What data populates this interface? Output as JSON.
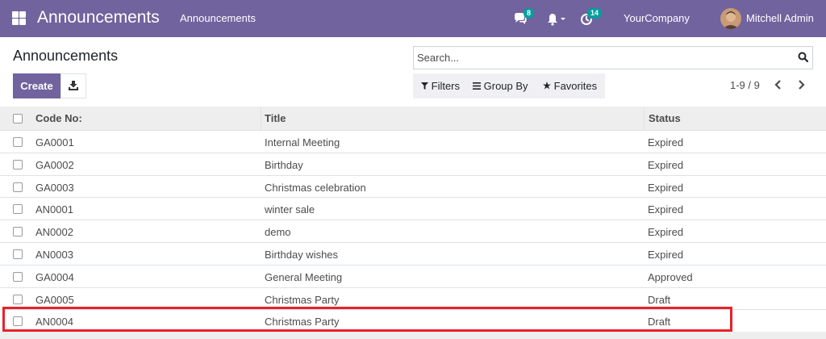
{
  "navbar": {
    "app_title": "Announcements",
    "menu_item": "Announcements",
    "chat_count": "8",
    "activity_count": "14",
    "company": "YourCompany",
    "user": "Mitchell Admin"
  },
  "control_panel": {
    "title": "Announcements",
    "create_label": "Create",
    "search_placeholder": "Search...",
    "filters_label": "Filters",
    "group_by_label": "Group By",
    "favorites_label": "Favorites",
    "pager": "1-9 / 9"
  },
  "table": {
    "columns": [
      "Code No:",
      "Title",
      "Status"
    ],
    "rows": [
      {
        "code": "GA0001",
        "title": "Internal Meeting",
        "status": "Expired"
      },
      {
        "code": "GA0002",
        "title": "Birthday",
        "status": "Expired"
      },
      {
        "code": "GA0003",
        "title": "Christmas celebration",
        "status": "Expired"
      },
      {
        "code": "AN0001",
        "title": "winter sale",
        "status": "Expired"
      },
      {
        "code": "AN0002",
        "title": "demo",
        "status": "Expired"
      },
      {
        "code": "AN0003",
        "title": "Birthday wishes",
        "status": "Expired"
      },
      {
        "code": "GA0004",
        "title": "General Meeting",
        "status": "Approved"
      },
      {
        "code": "GA0005",
        "title": "Christmas Party",
        "status": "Draft"
      },
      {
        "code": "AN0004",
        "title": "Christmas Party",
        "status": "Draft"
      }
    ]
  },
  "colors": {
    "brand": "#71639e",
    "badge": "#00a09d",
    "highlight": "#e8222a"
  }
}
